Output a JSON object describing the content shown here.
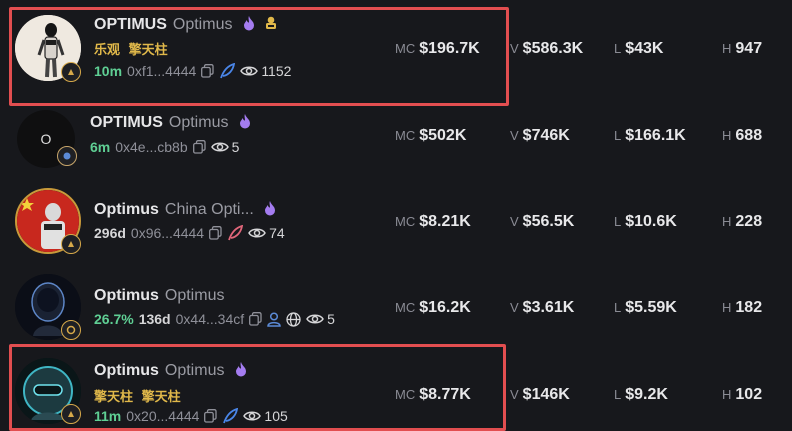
{
  "rows": [
    {
      "symbol": "OPTIMUS",
      "name": "Optimus",
      "tags": [
        "乐观",
        "擎天柱"
      ],
      "age": "10m",
      "address": "0xf1...4444",
      "views": "1152",
      "mc": "$196.7K",
      "v": "$586.3K",
      "l": "$43K",
      "h": "947"
    },
    {
      "symbol": "OPTIMUS",
      "name": "Optimus",
      "avatar_text": "O",
      "age": "6m",
      "address": "0x4e...cb8b",
      "views": "5",
      "mc": "$502K",
      "v": "$746K",
      "l": "$166.1K",
      "h": "688"
    },
    {
      "symbol": "Optimus",
      "name": "China Opti...",
      "age": "296d",
      "address": "0x96...4444",
      "views": "74",
      "mc": "$8.21K",
      "v": "$56.5K",
      "l": "$10.6K",
      "h": "228"
    },
    {
      "symbol": "Optimus",
      "name": "Optimus",
      "pct": "26.7%",
      "age": "136d",
      "address": "0x44...34cf",
      "views": "5",
      "mc": "$16.2K",
      "v": "$3.61K",
      "l": "$5.59K",
      "h": "182"
    },
    {
      "symbol": "Optimus",
      "name": "Optimus",
      "tags": [
        "擎天柱",
        "擎天柱"
      ],
      "age": "11m",
      "address": "0x20...4444",
      "views": "105",
      "mc": "$8.77K",
      "v": "$146K",
      "l": "$9.2K",
      "h": "102"
    }
  ],
  "labels": {
    "mc": "MC",
    "v": "V",
    "l": "L",
    "h": "H"
  },
  "icons": [
    "flame-icon",
    "chef-hat-icon",
    "copy-icon",
    "feather-icon",
    "eye-icon",
    "user-icon",
    "globe-icon",
    "badge-icon"
  ],
  "colors": {
    "highlight": "#e24e50",
    "age_green": "#5fcf94",
    "tag_gold": "#e0b84a",
    "flame": "#a47cf0"
  }
}
